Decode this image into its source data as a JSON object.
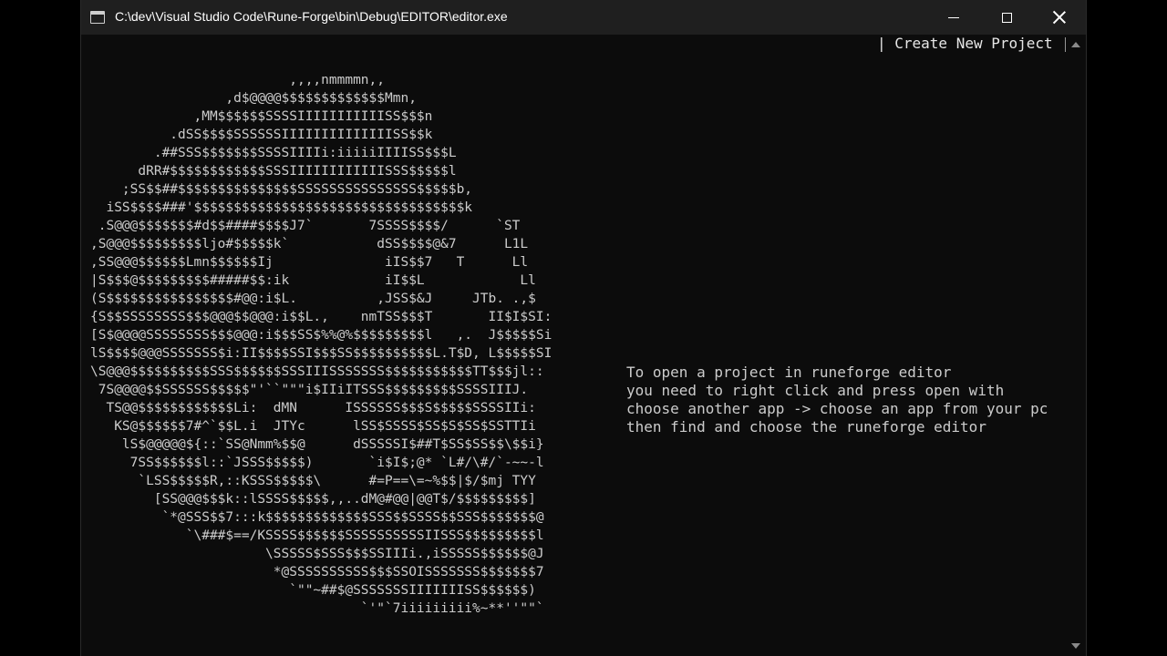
{
  "window": {
    "title": "C:\\dev\\Visual Studio Code\\Rune-Forge\\bin\\Debug\\EDITOR\\editor.exe"
  },
  "icons": {
    "app": "console-app-icon",
    "minimize": "minimize-icon",
    "maximize": "maximize-icon",
    "close": "close-icon"
  },
  "console": {
    "menu_line": "| Create New Project |",
    "ascii_art": "                         ,,,,nmmmmn,,\n                 ,d$@@@@$$$$$$$$$$$$$Mmn,\n             ,MM$$$$$$SSSSIIIIIIIIIIISS$$$n\n          .dSS$$$$SSSSSSIIIIIIIIIIIIIISS$$k\n        .##SSS$$$$$$$SSSSIIIIi:iiiiiIIIISS$$$L\n      dRR#$$$$$$$$$$$$SSSIIIIIIIIIIIISSS$$$$$l\n    ;SS$$##$$$$$$$$$$$$$$$SSSSSSSSSSSSSSS$$$$$b,\n  iSS$$$$###'$$$$$$$$$$$$$$$$$$$$$$$$$$$$$$$$$$k\n .S@@@$$$$$$$#d$$####$$$$J7`       7SSSS$$$$/      `ST\n,S@@@$$$$$$$$$ljo#$$$$$k`           dSS$$$$@&7      L1L\n,SS@@@$$$$$$Lmn$$$$$$Ij              iIS$$7   T      Ll\n|S$$$@$$$$$$$$$#####$$:ik            iI$$L            Ll\n(S$$$$$$$$$$$$$$$$#@@:i$L.          ,JSS$&J     JTb. .,$\n{S$$SSSSSSSS$$$@@@$$@@@:i$$L.,    nmTSS$$$T       II$I$SI:\n[S$@@@@SSSSSSSS$$$@@@:i$$$SS$%%@%$$$$$$$$$l   ,.  J$$$$$Si\nlS$$$$@@@SSSSSSS$i:II$$$$SSI$$$SS$$$$$$$$$$L.T$D, L$$$$$SI\n\\S@@@$$$$$$$$$$SSS$$$$$$SSSIIISSSSSSS$$$$$$$$$$$TT$$$jl::\n 7S@@@@$$SSSSSS$$$$$\"'``\"\"\"i$IIiITSSS$$$$$$$$$SSSSIIIJ.\n  TS@@$$$$$$$$$$$$Li:  dMN      ISSSSSS$$$S$$$$$SSSSIIi:\n   KS@$$$$$$7#^`$$L.i  JTYc      lSS$SSSS$SS$S$SS$SSTTIi\n    lS$@@@@@${::`SS@Nmm%$$@      dSSSSSI$##T$SS$SS$$\\$$i}\n     7SS$$$$$$l::`JSSS$$$$$)       `i$I$;@* `L#/\\#/`-~~-l\n      `LSS$$$$$R,::KSSS$$$$$\\      #=P==\\=~%$$|$/$mj TYY\n        [SS@@@$$$k::lSSSS$$$$$,,..dM@#@@|@@T$/$$$$$$$$$]\n         `*@SSS$$7:::k$$$$$$$$$$$$$SSS$$SSSS$$SSS$$$$$$$@\n            `\\###$==/KSSSS$$$$$$SSSSSSSSSSIISSS$$$$$$$$$l\n                      \\SSSSS$SSS$$$SSIIIi.,iSSSSS$$$$$$@J\n                       *@SSSSSSSSSS$$$SSOISSSSSSS$$$$$$$7\n                         `\"\"~##$@SSSSSSSIIIIIIISS$$$$$$)\n                                  `'\"`7iiiiiiiii%~**''\"\"`",
    "instructions": "To open a project in runeforge editor\nyou need to right click and press open with\nchoose another app -> choose an app from your pc\nthen find and choose the runeforge editor"
  }
}
